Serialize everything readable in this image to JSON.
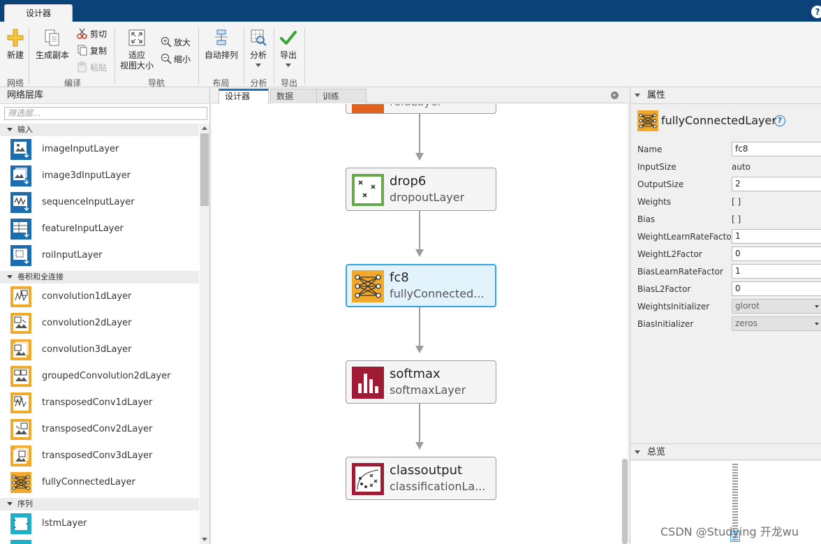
{
  "toolstrip": {
    "tab": "设计器",
    "help": "?"
  },
  "ribbon": {
    "new_label": "新建",
    "duplicate_label": "生成副本",
    "cut_label": "剪切",
    "copy_label": "复制",
    "paste_label": "粘贴",
    "fit_label_1": "适应",
    "fit_label_2": "视图大小",
    "zoom_in_label": "放大",
    "zoom_out_label": "缩小",
    "auto_arrange_label": "自动排列",
    "analyze_label": "分析",
    "export_label": "导出",
    "groups": {
      "network": "网络",
      "edit": "编译",
      "navigate": "导航",
      "layout": "布局",
      "analysis": "分析",
      "export": "导出"
    }
  },
  "library": {
    "title": "网络层库",
    "filter_placeholder": "筛选层...",
    "sections": [
      "输入",
      "卷积和全连接",
      "序列"
    ],
    "input_items": [
      "imageInputLayer",
      "image3dInputLayer",
      "sequenceInputLayer",
      "featureInputLayer",
      "roiInputLayer"
    ],
    "conv_items": [
      "convolution1dLayer",
      "convolution2dLayer",
      "convolution3dLayer",
      "groupedConvolution2dLayer",
      "transposedConv1dLayer",
      "transposedConv2dLayer",
      "transposedConv3dLayer",
      "fullyConnectedLayer"
    ],
    "sequence_items": [
      "lstmLayer"
    ]
  },
  "doc_tabs": [
    "设计器",
    "数据",
    "训练"
  ],
  "graph": {
    "nodes": [
      {
        "name": "",
        "type": "reluLayer"
      },
      {
        "name": "drop6",
        "type": "dropoutLayer"
      },
      {
        "name": "fc8",
        "type": "fullyConnected..."
      },
      {
        "name": "softmax",
        "type": "softmaxLayer"
      },
      {
        "name": "classoutput",
        "type": "classificationLa..."
      }
    ]
  },
  "properties": {
    "header": "属性",
    "layer_type": "fullyConnectedLayer",
    "help": "?",
    "rows": [
      {
        "label": "Name",
        "value": "fc8"
      },
      {
        "label": "InputSize",
        "value": "auto"
      },
      {
        "label": "OutputSize",
        "value": "2"
      },
      {
        "label": "Weights",
        "value": "[ ]"
      },
      {
        "label": "Bias",
        "value": "[ ]"
      },
      {
        "label": "WeightLearnRateFactor",
        "value": "1"
      },
      {
        "label": "WeightL2Factor",
        "value": "0"
      },
      {
        "label": "BiasLearnRateFactor",
        "value": "1"
      },
      {
        "label": "BiasL2Factor",
        "value": "0"
      },
      {
        "label": "WeightsInitializer",
        "value": "glorot"
      },
      {
        "label": "BiasInitializer",
        "value": "zeros"
      }
    ]
  },
  "overview": {
    "header": "总览"
  },
  "watermark": "CSDN @Studying 开龙wu",
  "colors": {
    "titlebar": "#0b4378",
    "selection": "#33a4e6",
    "fc_icon": "#f0a92b",
    "dropout_icon": "#6aa84f",
    "softmax_icon": "#a01c34",
    "relu_icon": "#e2601e",
    "input_icon": "#1b6db2",
    "lstm_icon": "#1fb0c8"
  }
}
